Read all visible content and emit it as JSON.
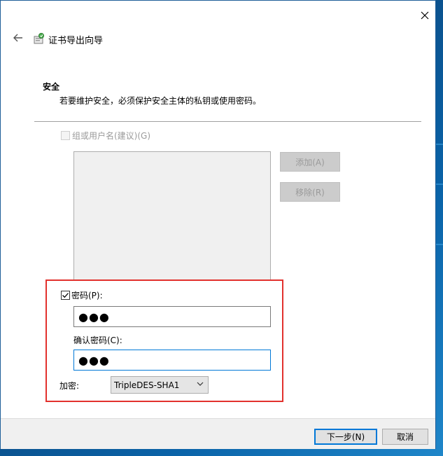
{
  "header": {
    "title": "证书导出向导"
  },
  "section": {
    "title": "安全",
    "description": "若要维护安全，必须保护安全主体的私钥或使用密码。"
  },
  "group_option": {
    "label": "组或用户名(建议)(G)",
    "checked": false,
    "disabled": true
  },
  "buttons": {
    "add": "添加(A)",
    "remove": "移除(R)",
    "next": "下一步(N)",
    "cancel": "取消"
  },
  "password": {
    "checkbox_label": "密码(P):",
    "checked": true,
    "value": "●●●",
    "confirm_label": "确认密码(C):",
    "confirm_value": "●●●"
  },
  "encryption": {
    "label": "加密:",
    "selected": "TripleDES-SHA1"
  },
  "colors": {
    "highlight": "#e2312d",
    "focus": "#0078d7"
  }
}
